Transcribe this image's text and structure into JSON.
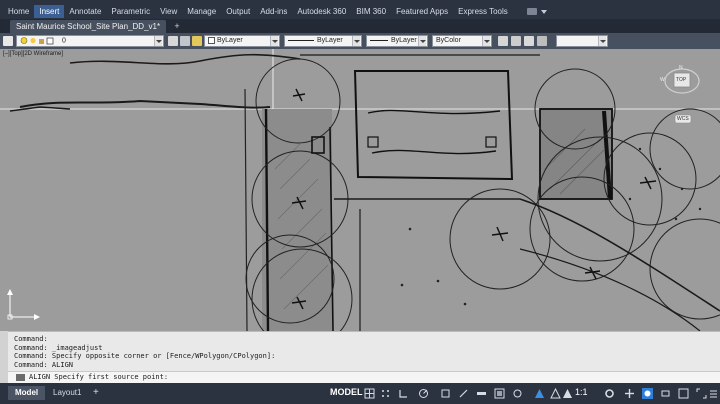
{
  "menu": {
    "tabs": [
      {
        "label": "Home"
      },
      {
        "label": "Insert"
      },
      {
        "label": "Annotate"
      },
      {
        "label": "Parametric"
      },
      {
        "label": "View"
      },
      {
        "label": "Manage"
      },
      {
        "label": "Output"
      },
      {
        "label": "Add-ins"
      },
      {
        "label": "Autodesk 360"
      },
      {
        "label": "BIM 360"
      },
      {
        "label": "Featured Apps"
      },
      {
        "label": "Express Tools"
      }
    ],
    "active_tab": "Insert"
  },
  "document": {
    "tab_title": "Saint Maurice School_Site Plan_DD_v1*",
    "new_tab_label": "+"
  },
  "properties": {
    "layer_value": "0",
    "color": "ByLayer",
    "linetype": "ByLayer",
    "lineweight": "ByLayer",
    "plot_style": "ByColor"
  },
  "viewport": {
    "label": "[–][Top][2D Wireframe]"
  },
  "viewcube": {
    "face": "TOP",
    "compass_n": "N",
    "compass_w": "W",
    "ucs": "WCS"
  },
  "command": {
    "history": [
      "Command:",
      "Command: _imageadjust",
      "Command: Specify opposite corner or [Fence/WPolygon/CPolygon]:",
      "Command: ALIGN"
    ],
    "prompt": "ALIGN Specify first source point:"
  },
  "status": {
    "model_tab": "Model",
    "layout_tab": "Layout1",
    "add_layout": "+",
    "space": "MODEL",
    "scale": "1:1"
  },
  "colors": {
    "ribbon_bg": "#2b3240",
    "active_tab": "#3b5f92",
    "drawing_bg": "#9c9c9c",
    "command_bg": "#e9e9e9",
    "status_bg": "#2c3340"
  },
  "icons": {
    "layer_icons": [
      "lightbulb-icon",
      "sun-icon",
      "lock-icon",
      "layer-color-icon"
    ],
    "status_icons": [
      "grid-icon",
      "snap-icon",
      "ortho-icon",
      "polar-icon",
      "osnap-icon",
      "annotation-scale-icon",
      "workspace-gear-icon",
      "plus-icon",
      "isolate-icon",
      "hardware-accel-icon",
      "fullscreen-icon",
      "customize-icon"
    ]
  }
}
